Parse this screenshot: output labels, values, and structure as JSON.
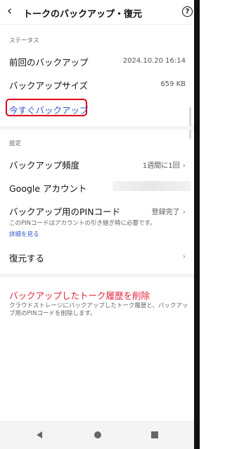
{
  "header": {
    "title": "トークのバックアップ・復元",
    "help_icon_text": "?"
  },
  "status_section": {
    "label": "ステータス",
    "last_backup_label": "前回のバックアップ",
    "last_backup_value": "2024.10.20 16:14",
    "backup_size_label": "バックアップサイズ",
    "backup_size_value": "659 KB",
    "backup_now_label": "今すぐバックアップ"
  },
  "settings_section": {
    "label": "設定",
    "frequency_label": "バックアップ頻度",
    "frequency_value": "1週間に1回",
    "google_account_label": "Google アカウント",
    "pin_label": "バックアップ用のPINコード",
    "pin_value": "登録完了",
    "pin_note": "このPINコードはアカウントの引き継ぎ時に必要です。",
    "details_link": "詳細を見る",
    "restore_label": "復元する"
  },
  "danger_section": {
    "delete_label": "バックアップしたトーク履歴を削除",
    "delete_description": "クラウドストレージにバックアップしたトーク履歴と、バックアップ用のPINコードを削除します。"
  },
  "icons": {
    "back": "chevron-left-icon",
    "help": "help-circle-icon",
    "chevron": "chevron-right-icon"
  },
  "colors": {
    "highlight_border": "#e0001b",
    "link": "#3558c8",
    "danger": "#e0203c"
  }
}
